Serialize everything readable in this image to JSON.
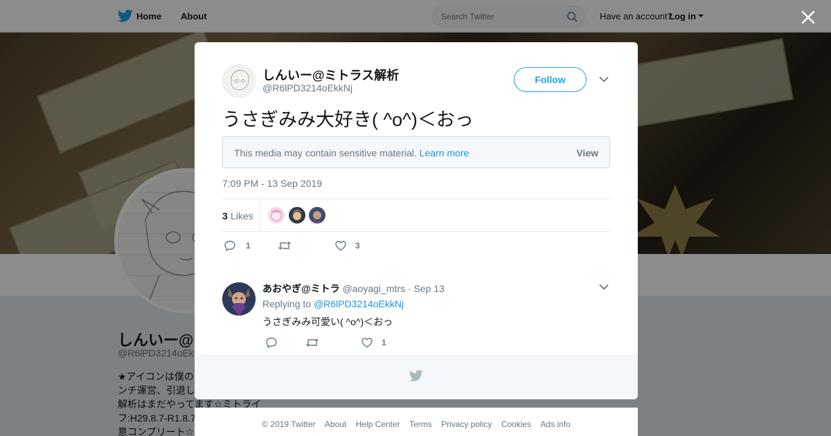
{
  "nav": {
    "home": "Home",
    "about": "About",
    "search_placeholder": "Search Twitter",
    "have_account": "Have an account?",
    "login": "Log in"
  },
  "profile": {
    "name": "しんいー@",
    "handle": "@R6lPD3214oEk",
    "bio": "★アイコンは僕の\nンチ運営、引退し\n解析はまだやってます☆ミトライ\nフ:H29.8.7-R1.8.7\n意コンプリート☆"
  },
  "tweet": {
    "name": "しんいー@ミトラス解析",
    "handle": "@R6lPD3214oEkkNj",
    "follow": "Follow",
    "text": "うさぎみみ大好き(  ^o^)＜おっ",
    "sensitive_text": "This media may contain sensitive material.",
    "learn_more": "Learn more",
    "view": "View",
    "timestamp": "7:09 PM - 13 Sep 2019",
    "likes_count": "3",
    "likes_label": "Likes",
    "reply_count": "1",
    "retweet_count": "",
    "like_count": "3"
  },
  "reply": {
    "name": "あおやぎ@ミトラ",
    "handle": "@aoyagi_mtrs",
    "date": "· Sep 13",
    "replying_to_label": "Replying to",
    "replying_to": "@R6lPD3214oEkkNj",
    "text": "うさぎみみ可愛い(  ^o^)＜おっ",
    "reply_count": "",
    "retweet_count": "",
    "like_count": "1"
  },
  "footer": {
    "copyright": "© 2019 Twitter",
    "about": "About",
    "help": "Help Center",
    "terms": "Terms",
    "privacy": "Privacy policy",
    "cookies": "Cookies",
    "ads": "Ads info"
  },
  "colors": {
    "accent": "#1da1f2",
    "link": "#1b95e0",
    "muted": "#657786"
  }
}
